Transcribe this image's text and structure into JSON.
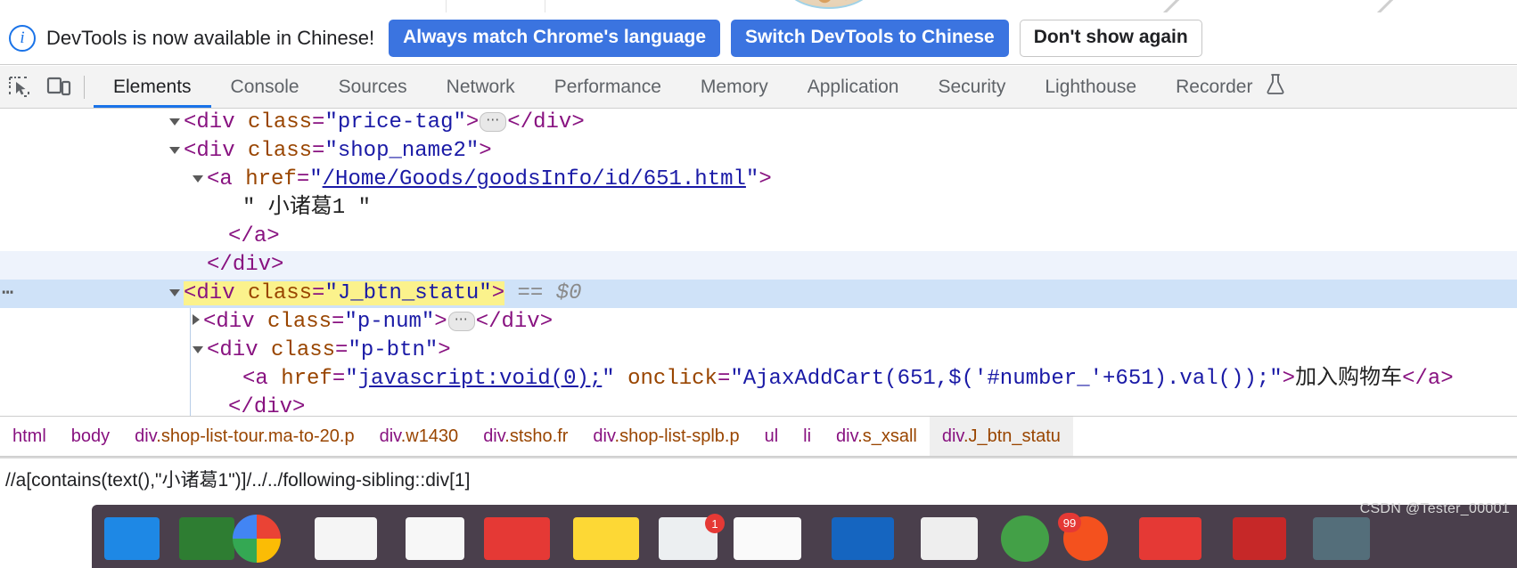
{
  "notification": {
    "icon": "info-icon",
    "message": "DevTools is now available in Chinese!",
    "buttons": [
      {
        "label": "Always match Chrome's language",
        "style": "primary"
      },
      {
        "label": "Switch DevTools to Chinese",
        "style": "primary"
      },
      {
        "label": "Don't show again",
        "style": "secondary"
      }
    ]
  },
  "toolbar": {
    "inspect_icon": "inspect-element-icon",
    "device_icon": "device-toolbar-icon",
    "tabs": [
      {
        "label": "Elements",
        "active": true
      },
      {
        "label": "Console",
        "active": false
      },
      {
        "label": "Sources",
        "active": false
      },
      {
        "label": "Network",
        "active": false
      },
      {
        "label": "Performance",
        "active": false
      },
      {
        "label": "Memory",
        "active": false
      },
      {
        "label": "Application",
        "active": false
      },
      {
        "label": "Security",
        "active": false
      },
      {
        "label": "Lighthouse",
        "active": false
      },
      {
        "label": "Recorder",
        "active": false,
        "icon": "flask-icon"
      }
    ]
  },
  "dom_tree": {
    "rows": [
      {
        "id": "row-price-tag",
        "indent": 190,
        "marker": "open",
        "state": "normal",
        "segments": [
          {
            "t": "punct",
            "v": "<"
          },
          {
            "t": "tag",
            "v": "div"
          },
          {
            "t": "sp",
            "v": " "
          },
          {
            "t": "attr",
            "v": "class"
          },
          {
            "t": "punct",
            "v": "="
          },
          {
            "t": "val",
            "v": "\"price-tag\""
          },
          {
            "t": "punct",
            "v": ">"
          },
          {
            "t": "badge",
            "v": "…"
          },
          {
            "t": "punct",
            "v": "</"
          },
          {
            "t": "tag",
            "v": "div"
          },
          {
            "t": "punct",
            "v": ">"
          }
        ]
      },
      {
        "id": "row-shop-name2",
        "indent": 190,
        "marker": "open",
        "state": "normal",
        "segments": [
          {
            "t": "punct",
            "v": "<"
          },
          {
            "t": "tag",
            "v": "div"
          },
          {
            "t": "sp",
            "v": " "
          },
          {
            "t": "attr",
            "v": "class"
          },
          {
            "t": "punct",
            "v": "="
          },
          {
            "t": "val",
            "v": "\"shop_name2\""
          },
          {
            "t": "punct",
            "v": ">"
          }
        ]
      },
      {
        "id": "row-anchor-goods",
        "indent": 216,
        "marker": "open",
        "state": "normal",
        "segments": [
          {
            "t": "punct",
            "v": "<"
          },
          {
            "t": "tag",
            "v": "a"
          },
          {
            "t": "sp",
            "v": " "
          },
          {
            "t": "attr",
            "v": "href"
          },
          {
            "t": "punct",
            "v": "="
          },
          {
            "t": "val",
            "v": "\""
          },
          {
            "t": "link",
            "v": "/Home/Goods/goodsInfo/id/651.html"
          },
          {
            "t": "val",
            "v": "\""
          },
          {
            "t": "punct",
            "v": ">"
          }
        ]
      },
      {
        "id": "row-text-node",
        "indent": 256,
        "marker": "none",
        "state": "normal",
        "segments": [
          {
            "t": "txt",
            "v": "\" 小诸葛1 \""
          }
        ]
      },
      {
        "id": "row-close-a",
        "indent": 240,
        "marker": "none",
        "state": "normal",
        "segments": [
          {
            "t": "punct",
            "v": "</"
          },
          {
            "t": "tag",
            "v": "a"
          },
          {
            "t": "punct",
            "v": ">"
          }
        ]
      },
      {
        "id": "row-close-div-shopname",
        "indent": 216,
        "marker": "none",
        "state": "hovered",
        "segments": [
          {
            "t": "punct",
            "v": "</"
          },
          {
            "t": "tag",
            "v": "div"
          },
          {
            "t": "punct",
            "v": ">"
          }
        ]
      },
      {
        "id": "row-j-btn-statu",
        "indent": 190,
        "marker": "open",
        "state": "selected",
        "left_dots": "⋯",
        "highlight": true,
        "segments": [
          {
            "t": "punct",
            "v": "<"
          },
          {
            "t": "tag",
            "v": "div"
          },
          {
            "t": "sp",
            "v": " "
          },
          {
            "t": "attr",
            "v": "class"
          },
          {
            "t": "punct",
            "v": "="
          },
          {
            "t": "val",
            "v": "\"J_btn_statu\""
          },
          {
            "t": "punct",
            "v": ">"
          },
          {
            "t": "nohl-sp",
            "v": " "
          },
          {
            "t": "eq",
            "v": "=="
          },
          {
            "t": "sp",
            "v": " "
          },
          {
            "t": "dollar",
            "v": "$0"
          }
        ]
      },
      {
        "id": "row-p-num",
        "indent": 216,
        "marker": "closed",
        "state": "normal",
        "segments": [
          {
            "t": "punct",
            "v": "<"
          },
          {
            "t": "tag",
            "v": "div"
          },
          {
            "t": "sp",
            "v": " "
          },
          {
            "t": "attr",
            "v": "class"
          },
          {
            "t": "punct",
            "v": "="
          },
          {
            "t": "val",
            "v": "\"p-num\""
          },
          {
            "t": "punct",
            "v": ">"
          },
          {
            "t": "badge",
            "v": "…"
          },
          {
            "t": "punct",
            "v": "</"
          },
          {
            "t": "tag",
            "v": "div"
          },
          {
            "t": "punct",
            "v": ">"
          }
        ]
      },
      {
        "id": "row-p-btn",
        "indent": 216,
        "marker": "open",
        "state": "normal",
        "segments": [
          {
            "t": "punct",
            "v": "<"
          },
          {
            "t": "tag",
            "v": "div"
          },
          {
            "t": "sp",
            "v": " "
          },
          {
            "t": "attr",
            "v": "class"
          },
          {
            "t": "punct",
            "v": "="
          },
          {
            "t": "val",
            "v": "\"p-btn\""
          },
          {
            "t": "punct",
            "v": ">"
          }
        ]
      },
      {
        "id": "row-add-cart-anchor",
        "indent": 256,
        "marker": "none",
        "state": "normal",
        "segments": [
          {
            "t": "punct",
            "v": "<"
          },
          {
            "t": "tag",
            "v": "a"
          },
          {
            "t": "sp",
            "v": " "
          },
          {
            "t": "attr",
            "v": "href"
          },
          {
            "t": "punct",
            "v": "="
          },
          {
            "t": "val",
            "v": "\""
          },
          {
            "t": "link",
            "v": "javascript:void(0);"
          },
          {
            "t": "val",
            "v": "\""
          },
          {
            "t": "sp",
            "v": " "
          },
          {
            "t": "attr",
            "v": "onclick"
          },
          {
            "t": "punct",
            "v": "="
          },
          {
            "t": "val",
            "v": "\"AjaxAddCart(651,$('#number_'+651).val());\""
          },
          {
            "t": "punct",
            "v": ">"
          },
          {
            "t": "txt",
            "v": "加入购物车"
          },
          {
            "t": "punct",
            "v": "</"
          },
          {
            "t": "tag",
            "v": "a"
          },
          {
            "t": "punct",
            "v": ">"
          }
        ]
      },
      {
        "id": "row-close-div-pbtn",
        "indent": 240,
        "marker": "none",
        "state": "normal",
        "segments": [
          {
            "t": "punct",
            "v": "</"
          },
          {
            "t": "tag",
            "v": "div"
          },
          {
            "t": "punct",
            "v": ">"
          }
        ]
      }
    ]
  },
  "breadcrumb": {
    "items": [
      {
        "tag": "html",
        "cls": "",
        "selected": false
      },
      {
        "tag": "body",
        "cls": "",
        "selected": false
      },
      {
        "tag": "div",
        "cls": ".shop-list-tour.ma-to-20.p",
        "selected": false
      },
      {
        "tag": "div",
        "cls": ".w1430",
        "selected": false
      },
      {
        "tag": "div",
        "cls": ".stsho.fr",
        "selected": false
      },
      {
        "tag": "div",
        "cls": ".shop-list-splb.p",
        "selected": false
      },
      {
        "tag": "ul",
        "cls": "",
        "selected": false
      },
      {
        "tag": "li",
        "cls": "",
        "selected": false
      },
      {
        "tag": "div",
        "cls": ".s_xsall",
        "selected": false
      },
      {
        "tag": "div",
        "cls": ".J_btn_statu",
        "selected": true
      }
    ]
  },
  "search": {
    "query": "//a[contains(text(),\"小诸葛1\")]/../../following-sibling::div[1]"
  },
  "watermark": {
    "text": "CSDN @Tester_00001"
  },
  "colors": {
    "accent_blue": "#1a73e8",
    "button_blue": "#3b74e0",
    "selection_blue": "#cfe2f8",
    "hover_blue": "#eef3fc",
    "highlight_yellow": "#fbf28c",
    "tag_purple": "#881280",
    "attr_orange": "#994500",
    "value_blue": "#1a1aa6"
  }
}
